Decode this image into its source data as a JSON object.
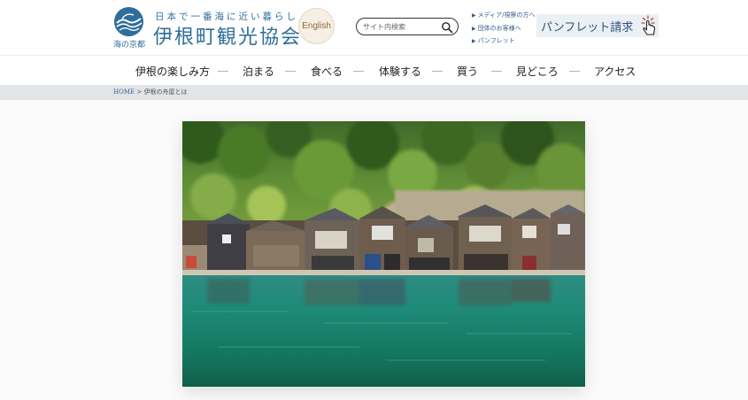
{
  "header": {
    "logo_sub": "海の京都",
    "tagline": "日本で一番海に近い暮らし",
    "org_name": "伊根町観光協会",
    "english_label": "English",
    "search_placeholder": "サイト内検索",
    "quick_links": [
      "メディア/視察の方へ",
      "団体のお客様へ",
      "パンフレット"
    ],
    "pamphlet_label": "パンフレット請求"
  },
  "nav": {
    "items": [
      "伊根の楽しみ方",
      "泊まる",
      "食べる",
      "体験する",
      "買う",
      "見どころ",
      "アクセス"
    ]
  },
  "breadcrumb": {
    "home": "HOME",
    "separator": " > ",
    "current": "伊根の舟屋とは"
  },
  "colors": {
    "brand_blue": "#2f6e9b",
    "link_blue": "#3a5b8c",
    "breadcrumb_bg": "#e1e5e8",
    "english_bg": "#f7efe3",
    "pamphlet_bg": "#eaf0f3",
    "pointer_accent": "#d13a3a"
  },
  "icons": {
    "logo": "wave-logo-icon",
    "search": "search-icon",
    "pointer": "hand-pointer-icon",
    "link_marker": "triangle-right-icon"
  }
}
